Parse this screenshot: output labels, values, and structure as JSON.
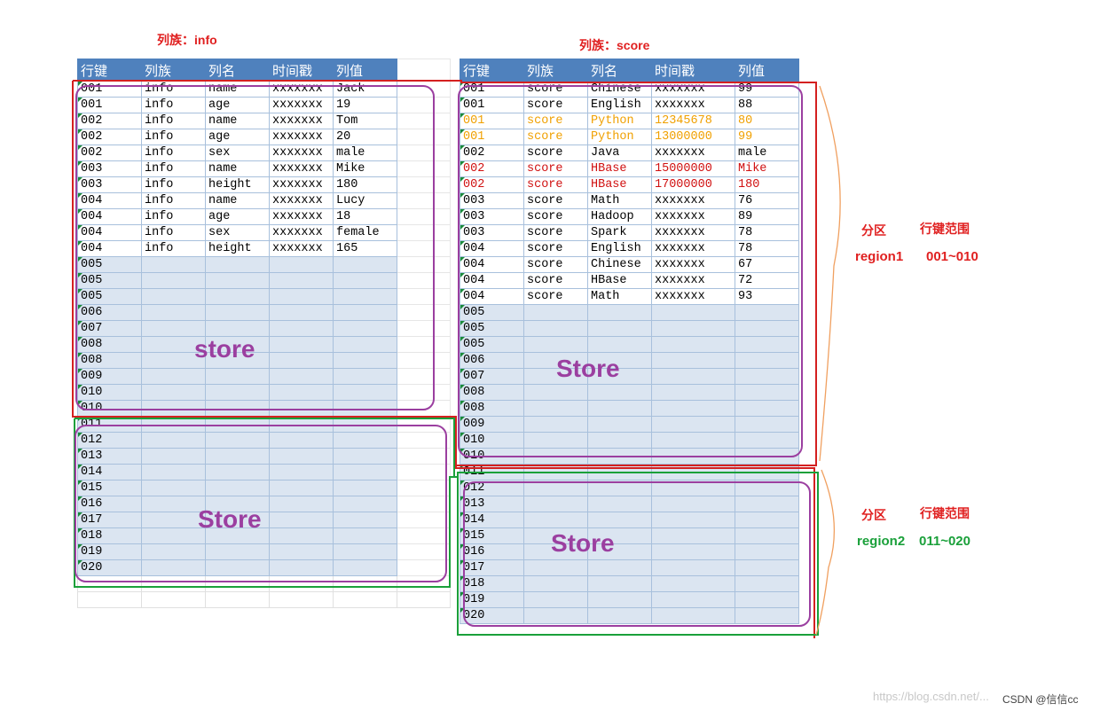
{
  "titles": {
    "left_cf": "列族：info",
    "right_cf": "列族：score"
  },
  "headers": [
    "行键",
    "列族",
    "列名",
    "时间戳",
    "列值"
  ],
  "left_rows": [
    {
      "cells": [
        "001",
        "info",
        "name",
        "xxxxxxx",
        "Jack"
      ],
      "style": "w"
    },
    {
      "cells": [
        "001",
        "info",
        "age",
        "xxxxxxx",
        "19"
      ],
      "style": "w"
    },
    {
      "cells": [
        "002",
        "info",
        "name",
        "xxxxxxx",
        "Tom"
      ],
      "style": "w"
    },
    {
      "cells": [
        "002",
        "info",
        "age",
        "xxxxxxx",
        "20"
      ],
      "style": "w"
    },
    {
      "cells": [
        "002",
        "info",
        "sex",
        "xxxxxxx",
        "male"
      ],
      "style": "w"
    },
    {
      "cells": [
        "003",
        "info",
        "name",
        "xxxxxxx",
        "Mike"
      ],
      "style": "w"
    },
    {
      "cells": [
        "003",
        "info",
        "height",
        "xxxxxxx",
        "180"
      ],
      "style": "w"
    },
    {
      "cells": [
        "004",
        "info",
        "name",
        "xxxxxxx",
        "Lucy"
      ],
      "style": "w"
    },
    {
      "cells": [
        "004",
        "info",
        "age",
        "xxxxxxx",
        "18"
      ],
      "style": "w"
    },
    {
      "cells": [
        "004",
        "info",
        "sex",
        "xxxxxxx",
        "female"
      ],
      "style": "w"
    },
    {
      "cells": [
        "004",
        "info",
        "height",
        "xxxxxxx",
        "165"
      ],
      "style": "w"
    },
    {
      "cells": [
        "005",
        "",
        "",
        "",
        ""
      ],
      "style": ""
    },
    {
      "cells": [
        "005",
        "",
        "",
        "",
        ""
      ],
      "style": ""
    },
    {
      "cells": [
        "005",
        "",
        "",
        "",
        ""
      ],
      "style": ""
    },
    {
      "cells": [
        "006",
        "",
        "",
        "",
        ""
      ],
      "style": ""
    },
    {
      "cells": [
        "007",
        "",
        "",
        "",
        ""
      ],
      "style": ""
    },
    {
      "cells": [
        "008",
        "",
        "",
        "",
        ""
      ],
      "style": ""
    },
    {
      "cells": [
        "008",
        "",
        "",
        "",
        ""
      ],
      "style": ""
    },
    {
      "cells": [
        "009",
        "",
        "",
        "",
        ""
      ],
      "style": ""
    },
    {
      "cells": [
        "010",
        "",
        "",
        "",
        ""
      ],
      "style": ""
    },
    {
      "cells": [
        "010",
        "",
        "",
        "",
        ""
      ],
      "style": ""
    },
    {
      "cells": [
        "011",
        "",
        "",
        "",
        ""
      ],
      "style": ""
    },
    {
      "cells": [
        "012",
        "",
        "",
        "",
        ""
      ],
      "style": ""
    },
    {
      "cells": [
        "013",
        "",
        "",
        "",
        ""
      ],
      "style": ""
    },
    {
      "cells": [
        "014",
        "",
        "",
        "",
        ""
      ],
      "style": ""
    },
    {
      "cells": [
        "015",
        "",
        "",
        "",
        ""
      ],
      "style": ""
    },
    {
      "cells": [
        "016",
        "",
        "",
        "",
        ""
      ],
      "style": ""
    },
    {
      "cells": [
        "017",
        "",
        "",
        "",
        ""
      ],
      "style": ""
    },
    {
      "cells": [
        "018",
        "",
        "",
        "",
        ""
      ],
      "style": ""
    },
    {
      "cells": [
        "019",
        "",
        "",
        "",
        ""
      ],
      "style": ""
    },
    {
      "cells": [
        "020",
        "",
        "",
        "",
        ""
      ],
      "style": ""
    },
    {
      "cells": [
        "",
        "",
        "",
        "",
        ""
      ],
      "style": "empty"
    },
    {
      "cells": [
        "",
        "",
        "",
        "",
        ""
      ],
      "style": "empty"
    }
  ],
  "right_rows": [
    {
      "cells": [
        "001",
        "score",
        "Chinese",
        "xxxxxxx",
        "99"
      ],
      "style": "w"
    },
    {
      "cells": [
        "001",
        "score",
        "English",
        "xxxxxxx",
        "88"
      ],
      "style": "w"
    },
    {
      "cells": [
        "001",
        "score",
        "Python",
        "12345678",
        "80"
      ],
      "style": "w y"
    },
    {
      "cells": [
        "001",
        "score",
        "Python",
        "13000000",
        "99"
      ],
      "style": "w y"
    },
    {
      "cells": [
        "002",
        "score",
        "Java",
        "xxxxxxx",
        "male"
      ],
      "style": "w"
    },
    {
      "cells": [
        "002",
        "score",
        "HBase",
        "15000000",
        "Mike"
      ],
      "style": "w r"
    },
    {
      "cells": [
        "002",
        "score",
        "HBase",
        "17000000",
        "180"
      ],
      "style": "w r"
    },
    {
      "cells": [
        "003",
        "score",
        "Math",
        "xxxxxxx",
        "76"
      ],
      "style": "w"
    },
    {
      "cells": [
        "003",
        "score",
        "Hadoop",
        "xxxxxxx",
        "89"
      ],
      "style": "w"
    },
    {
      "cells": [
        "003",
        "score",
        "Spark",
        "xxxxxxx",
        "78"
      ],
      "style": "w"
    },
    {
      "cells": [
        "004",
        "score",
        "English",
        "xxxxxxx",
        "78"
      ],
      "style": "w"
    },
    {
      "cells": [
        "004",
        "score",
        "Chinese",
        "xxxxxxx",
        "67"
      ],
      "style": "w"
    },
    {
      "cells": [
        "004",
        "score",
        "HBase",
        "xxxxxxx",
        "72"
      ],
      "style": "w"
    },
    {
      "cells": [
        "004",
        "score",
        "Math",
        "xxxxxxx",
        "93"
      ],
      "style": "w"
    },
    {
      "cells": [
        "005",
        "",
        "",
        "",
        ""
      ],
      "style": ""
    },
    {
      "cells": [
        "005",
        "",
        "",
        "",
        ""
      ],
      "style": ""
    },
    {
      "cells": [
        "005",
        "",
        "",
        "",
        ""
      ],
      "style": ""
    },
    {
      "cells": [
        "006",
        "",
        "",
        "",
        ""
      ],
      "style": ""
    },
    {
      "cells": [
        "007",
        "",
        "",
        "",
        ""
      ],
      "style": ""
    },
    {
      "cells": [
        "008",
        "",
        "",
        "",
        ""
      ],
      "style": ""
    },
    {
      "cells": [
        "008",
        "",
        "",
        "",
        ""
      ],
      "style": ""
    },
    {
      "cells": [
        "009",
        "",
        "",
        "",
        ""
      ],
      "style": ""
    },
    {
      "cells": [
        "010",
        "",
        "",
        "",
        ""
      ],
      "style": ""
    },
    {
      "cells": [
        "010",
        "",
        "",
        "",
        ""
      ],
      "style": ""
    },
    {
      "cells": [
        "011",
        "",
        "",
        "",
        ""
      ],
      "style": ""
    },
    {
      "cells": [
        "012",
        "",
        "",
        "",
        ""
      ],
      "style": ""
    },
    {
      "cells": [
        "013",
        "",
        "",
        "",
        ""
      ],
      "style": ""
    },
    {
      "cells": [
        "014",
        "",
        "",
        "",
        ""
      ],
      "style": ""
    },
    {
      "cells": [
        "015",
        "",
        "",
        "",
        ""
      ],
      "style": ""
    },
    {
      "cells": [
        "016",
        "",
        "",
        "",
        ""
      ],
      "style": ""
    },
    {
      "cells": [
        "017",
        "",
        "",
        "",
        ""
      ],
      "style": ""
    },
    {
      "cells": [
        "018",
        "",
        "",
        "",
        ""
      ],
      "style": ""
    },
    {
      "cells": [
        "019",
        "",
        "",
        "",
        ""
      ],
      "style": ""
    },
    {
      "cells": [
        "020",
        "",
        "",
        "",
        ""
      ],
      "style": ""
    }
  ],
  "store_labels": {
    "left_top": "store",
    "left_bottom": "Store",
    "right_top": "Store",
    "right_bottom": "Store"
  },
  "regions": {
    "region1": {
      "partition_label": "分区",
      "range_label": "行键范围",
      "name": "region1",
      "range": "001~010",
      "color": "#e02020"
    },
    "region2": {
      "partition_label": "分区",
      "range_label": "行键范围",
      "name": "region2",
      "range": "011~020",
      "color": "#1aa03a"
    }
  },
  "colors": {
    "region1_border": "#d42020",
    "region2_border": "#1aa03a",
    "store_border": "#9b3fa0",
    "header_bg": "#4f81bd",
    "cell_bg": "#dbe5f1"
  },
  "watermark": "https://blog.csdn.net/...",
  "credit": "CSDN @信信cc"
}
